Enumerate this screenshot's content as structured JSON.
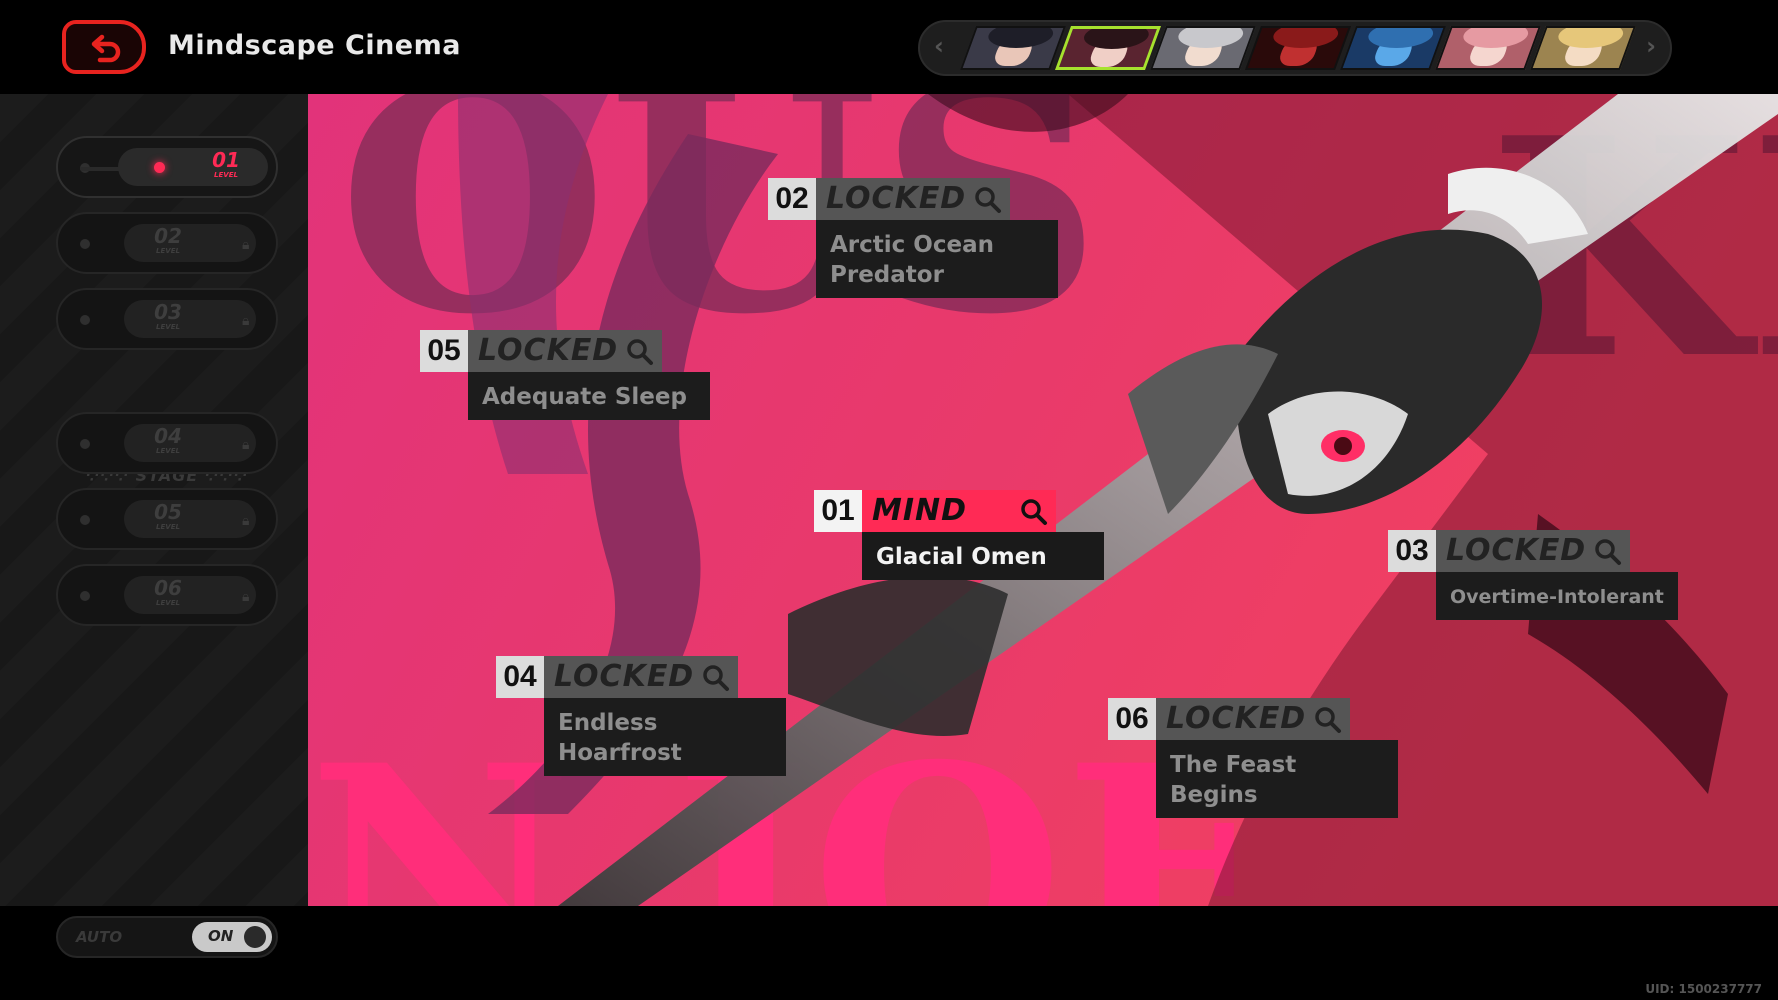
{
  "header": {
    "title": "Mindscape Cinema"
  },
  "character_selector": {
    "left_arrow": "‹",
    "right_arrow": "›",
    "portraits": [
      {
        "name": "portrait-1",
        "hair": "#1e1e28",
        "skin": "#e9c6b8",
        "bg": "#3a3a48",
        "active": false
      },
      {
        "name": "portrait-2",
        "hair": "#2a1418",
        "skin": "#f0cfc6",
        "bg": "#5a2430",
        "active": true
      },
      {
        "name": "portrait-3",
        "hair": "#c8c8cc",
        "skin": "#f1dccf",
        "bg": "#6a6a72",
        "active": false
      },
      {
        "name": "portrait-4",
        "hair": "#8a1a1a",
        "skin": "#c03030",
        "bg": "#2a0a0a",
        "active": false
      },
      {
        "name": "portrait-5",
        "hair": "#2f6fb0",
        "skin": "#5aa8e8",
        "bg": "#1a3a66",
        "active": false
      },
      {
        "name": "portrait-6",
        "hair": "#e69aa2",
        "skin": "#f5d6cf",
        "bg": "#b0606a",
        "active": false
      },
      {
        "name": "portrait-7",
        "hair": "#e6c77a",
        "skin": "#f4dcc4",
        "bg": "#9c8450",
        "active": false
      }
    ]
  },
  "sidebar": {
    "levels": [
      {
        "num": "01",
        "sub": "LEVEL",
        "active": true
      },
      {
        "num": "02",
        "sub": "LEVEL",
        "active": false
      },
      {
        "num": "03",
        "sub": "LEVEL",
        "active": false
      },
      {
        "num": "04",
        "sub": "LEVEL",
        "active": false
      },
      {
        "num": "05",
        "sub": "LEVEL",
        "active": false
      },
      {
        "num": "06",
        "sub": "LEVEL",
        "active": false
      }
    ],
    "stage_label": "STAGE",
    "auto_label": "AUTO",
    "auto_state": "ON"
  },
  "background": {
    "top_text": "OUS",
    "right_text": "KI",
    "bottom_text": "N JOE"
  },
  "mindscapes": {
    "n01": {
      "num": "01",
      "state": "MIND",
      "name": "Glacial Omen"
    },
    "n02": {
      "num": "02",
      "state": "LOCKED",
      "name": "Arctic Ocean Predator"
    },
    "n03": {
      "num": "03",
      "state": "LOCKED",
      "name": "Overtime-Intolerant"
    },
    "n04": {
      "num": "04",
      "state": "LOCKED",
      "name": "Endless Hoarfrost"
    },
    "n05": {
      "num": "05",
      "state": "LOCKED",
      "name": "Adequate Sleep"
    },
    "n06": {
      "num": "06",
      "state": "LOCKED",
      "name": "The Feast Begins"
    }
  },
  "footer": {
    "uid": "UID: 1500237777"
  },
  "colors": {
    "accent": "#ff2a55",
    "back_button": "#e8231f",
    "active_portrait_border": "#a6e22e",
    "magenta": "#e2337a"
  }
}
